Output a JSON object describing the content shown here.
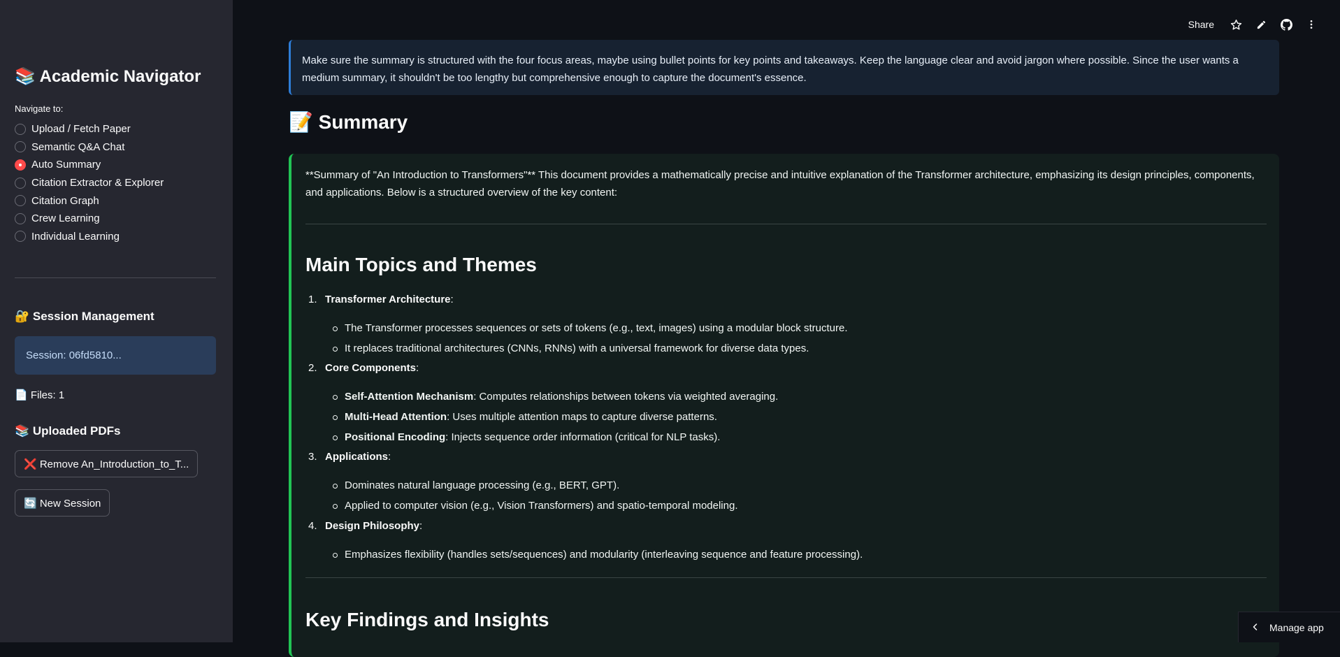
{
  "sidebar": {
    "title": "📚 Academic Navigator",
    "nav_label": "Navigate to:",
    "nav_items": [
      {
        "label": "Upload / Fetch Paper",
        "selected": false
      },
      {
        "label": "Semantic Q&A Chat",
        "selected": false
      },
      {
        "label": "Auto Summary",
        "selected": true
      },
      {
        "label": "Citation Extractor & Explorer",
        "selected": false
      },
      {
        "label": "Citation Graph",
        "selected": false
      },
      {
        "label": "Crew Learning",
        "selected": false
      },
      {
        "label": "Individual Learning",
        "selected": false
      }
    ],
    "session_heading": "🔐 Session Management",
    "session_label": "Session: 06fd5810...",
    "files_label": "📄 Files: 1",
    "uploaded_heading": "📚 Uploaded PDFs",
    "remove_button": "❌ Remove An_Introduction_to_T...",
    "new_session_button": "🔄 New Session"
  },
  "toolbar": {
    "share_label": "Share",
    "icons": [
      "star-icon",
      "edit-icon",
      "github-icon",
      "more-vert-icon"
    ]
  },
  "callout": {
    "text": "Make sure the summary is structured with the four focus areas, maybe using bullet points for key points and takeaways. Keep the language clear and avoid jargon where possible. Since the user wants a medium summary, it shouldn't be too lengthy but comprehensive enough to capture the document's essence."
  },
  "summary": {
    "heading": "📝 Summary",
    "intro": "**Summary of \"An Introduction to Transformers\"** This document provides a mathematically precise and intuitive explanation of the Transformer architecture, emphasizing its design principles, components, and applications. Below is a structured overview of the key content:",
    "section1_title": "Main Topics and Themes",
    "topics": [
      {
        "num": "1.",
        "title": "Transformer Architecture",
        "items": [
          {
            "bold": "",
            "text": "The Transformer processes sequences or sets of tokens (e.g., text, images) using a modular block structure."
          },
          {
            "bold": "",
            "text": "It replaces traditional architectures (CNNs, RNNs) with a universal framework for diverse data types."
          }
        ]
      },
      {
        "num": "2.",
        "title": "Core Components",
        "items": [
          {
            "bold": "Self-Attention Mechanism",
            "text": ": Computes relationships between tokens via weighted averaging."
          },
          {
            "bold": "Multi-Head Attention",
            "text": ": Uses multiple attention maps to capture diverse patterns."
          },
          {
            "bold": "Positional Encoding",
            "text": ": Injects sequence order information (critical for NLP tasks)."
          }
        ]
      },
      {
        "num": "3.",
        "title": "Applications",
        "items": [
          {
            "bold": "",
            "text": "Dominates natural language processing (e.g., BERT, GPT)."
          },
          {
            "bold": "",
            "text": "Applied to computer vision (e.g., Vision Transformers) and spatio-temporal modeling."
          }
        ]
      },
      {
        "num": "4.",
        "title": "Design Philosophy",
        "items": [
          {
            "bold": "",
            "text": "Emphasizes flexibility (handles sets/sequences) and modularity (interleaving sequence and feature processing)."
          }
        ]
      }
    ],
    "section2_title": "Key Findings and Insights"
  },
  "manage_app": {
    "label": "Manage app"
  },
  "colors": {
    "accent_red": "#ff4b4b",
    "info_blue": "#2e7dd7",
    "success_green": "#21c354",
    "sidebar_bg": "#262730",
    "main_bg": "#0e1117"
  }
}
